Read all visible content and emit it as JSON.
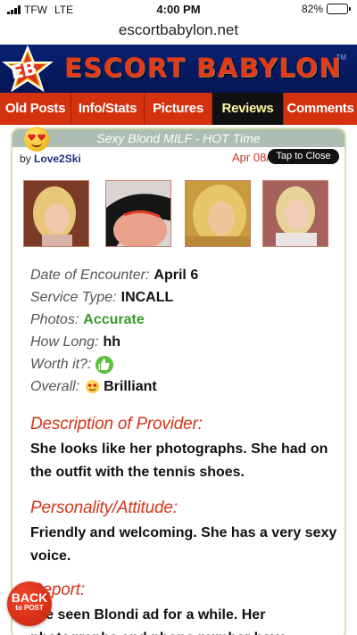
{
  "status_bar": {
    "carrier": "TFW",
    "network": "LTE",
    "time": "4:00 PM",
    "battery": "82%",
    "battery_level": 0.82
  },
  "browser": {
    "url": "escortbabylon.net"
  },
  "header": {
    "logo_mark": "EB",
    "brand": "ESCORT BABYLON",
    "trademark": "TM",
    "accent_color": "#d4310f",
    "bg_color": "#0a2170"
  },
  "nav": {
    "tabs": [
      {
        "label": "Old Posts"
      },
      {
        "label": "Info/Stats"
      },
      {
        "label": "Pictures"
      },
      {
        "label": "Reviews",
        "active": true
      },
      {
        "label": "Comments"
      }
    ]
  },
  "review": {
    "title": "Sexy Blond MILF - HOT Time",
    "by_prefix": "by",
    "author": "Love2Ski",
    "date": "Apr 08/23",
    "close_label": "Tap to Close",
    "title_emoji_icon": "heart-eyes-emoji-icon",
    "fields": [
      {
        "label": "Date of Encounter:",
        "value": "April 6"
      },
      {
        "label": "Service Type:",
        "value": "INCALL"
      },
      {
        "label": "Photos:",
        "value": "Accurate"
      },
      {
        "label": "How Long:",
        "value": "hh"
      },
      {
        "label": "Worth it?:",
        "value": "",
        "icon": "thumbs-up-icon"
      },
      {
        "label": "Overall:",
        "value": "Brilliant",
        "icon": "heart-eyes-emoji-icon"
      }
    ],
    "sections": [
      {
        "heading": "Description of Provider:",
        "body": "She looks like her photographs. She had on the outfit with the tennis shoes."
      },
      {
        "heading": "Personality/Attitude:",
        "body": "Friendly and welcoming. She has a very sexy voice."
      },
      {
        "heading": "Report:",
        "body": "I've seen Blondi ad for a while. Her photographs and phone number have"
      }
    ]
  },
  "back_button": {
    "line1": "BACK",
    "line2": "to POST"
  }
}
